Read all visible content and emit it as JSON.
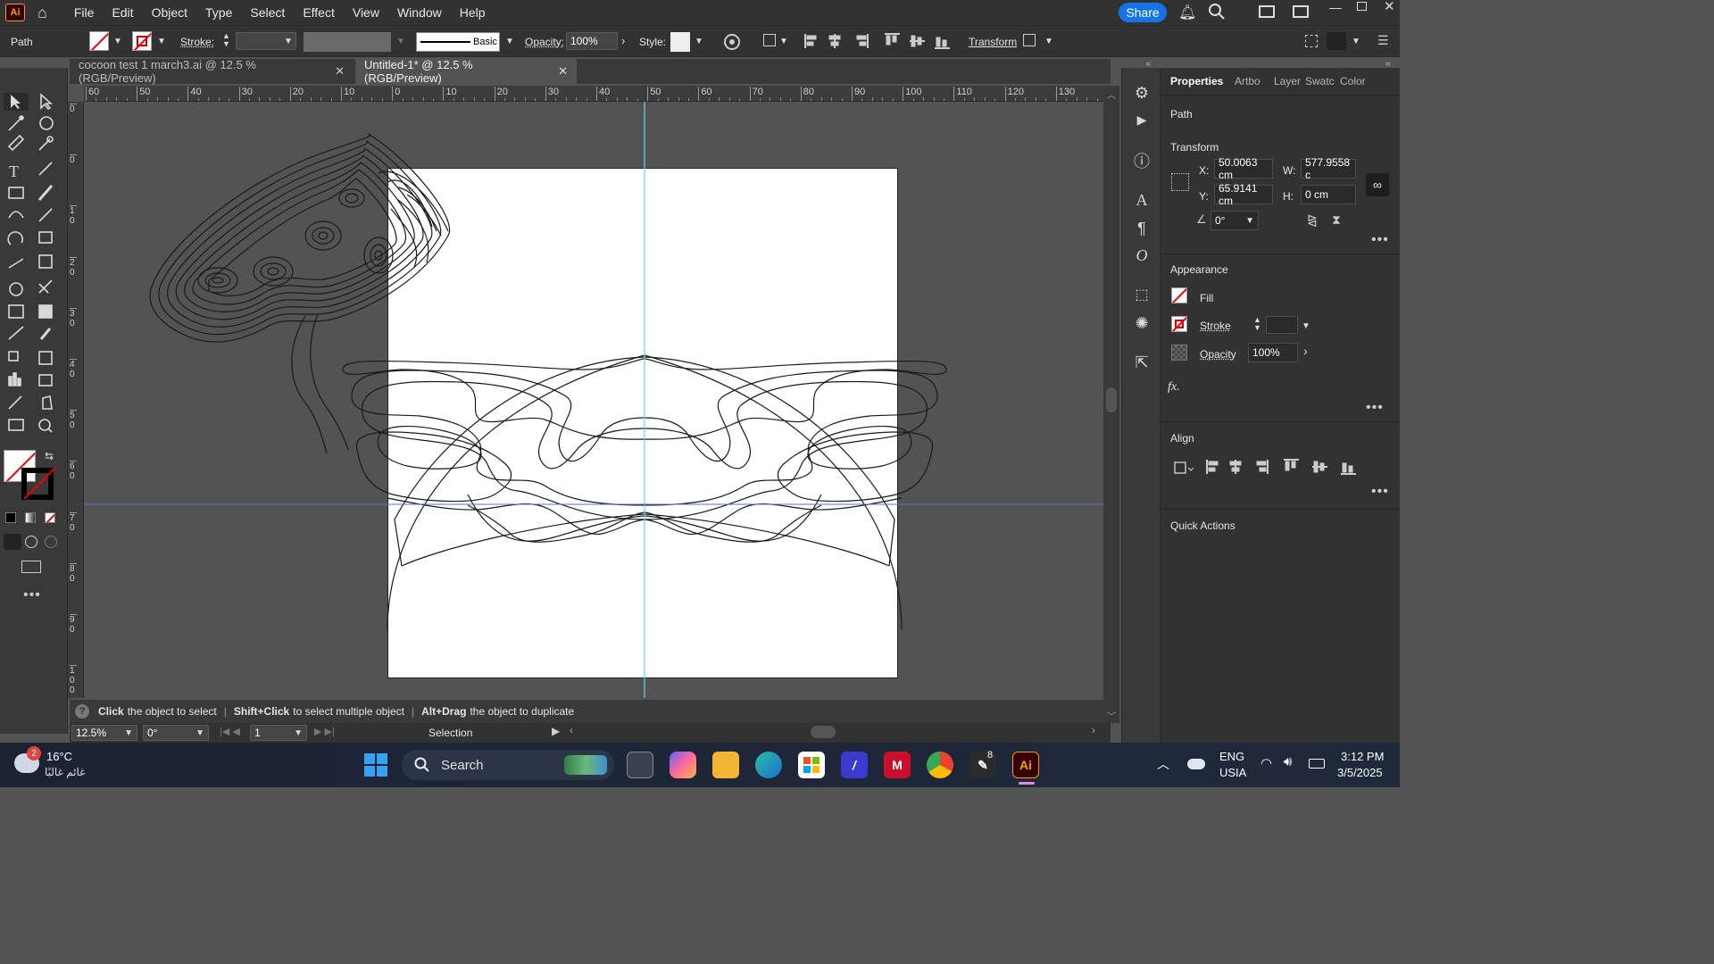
{
  "app": {
    "logo": "Ai",
    "share_label": "Share"
  },
  "menu": [
    "File",
    "Edit",
    "Object",
    "Type",
    "Select",
    "Effect",
    "View",
    "Window",
    "Help"
  ],
  "control": {
    "selection_type": "Path",
    "stroke_label": "Stroke:",
    "brush_label": "Basic",
    "opacity_label": "Opacity:",
    "opacity_value": "100%",
    "style_label": "Style:",
    "transform_label": "Transform"
  },
  "tabs": [
    {
      "label": "cocoon test 1 march3.ai @ 12.5 % (RGB/Preview)",
      "active": false
    },
    {
      "label": "Untitled-1* @ 12.5 % (RGB/Preview)",
      "active": true
    }
  ],
  "ruler": {
    "h_labels": [
      "60",
      "50",
      "40",
      "30",
      "20",
      "10",
      "0",
      "10",
      "20",
      "30",
      "40",
      "50",
      "60",
      "70",
      "80",
      "90",
      "100",
      "110",
      "120",
      "130"
    ],
    "v_labels": [
      "0",
      "0",
      "1 0",
      "2 0",
      "3 0",
      "4 0",
      "5 0",
      "6 0",
      "7 0",
      "8 0",
      "9 0",
      "1 0 0"
    ]
  },
  "status": {
    "click": "Click",
    "click_desc": "the object to select",
    "shift": "Shift+Click",
    "shift_desc": "to select multiple object",
    "alt": "Alt+Drag",
    "alt_desc": "the object to duplicate"
  },
  "bottom": {
    "zoom": "12.5%",
    "rotation": "0°",
    "artboard": "1",
    "tool": "Selection"
  },
  "panel": {
    "tabs": [
      "Properties",
      "Artbo",
      "Layer",
      "Swatc",
      "Color"
    ],
    "object_type": "Path",
    "transform_title": "Transform",
    "x_label": "X:",
    "x_value": "50.0063 cm",
    "y_label": "Y:",
    "y_value": "65.9141 cm",
    "w_label": "W:",
    "w_value": "577.9558 c",
    "h_label": "H:",
    "h_value": "0 cm",
    "angle_value": "0°",
    "appearance_title": "Appearance",
    "fill_label": "Fill",
    "stroke_label": "Stroke",
    "opacity_label": "Opacity",
    "opacity_value": "100%",
    "fx_label": "fx.",
    "align_title": "Align",
    "quick_actions_title": "Quick Actions"
  },
  "taskbar": {
    "weather_temp": "16°C",
    "weather_desc": "غائم غالبًا",
    "weather_badge": "2",
    "search_placeholder": "Search",
    "lang_top": "ENG",
    "lang_bottom": "USIA",
    "time": "3:12 PM",
    "date": "3/5/2025",
    "app_badge": "8"
  },
  "colors": {
    "accent": "#1473e6",
    "guide_cyan": "#5fd7e6",
    "guide_blue": "#5a6fd6",
    "ai_orange": "#ff9a00"
  }
}
